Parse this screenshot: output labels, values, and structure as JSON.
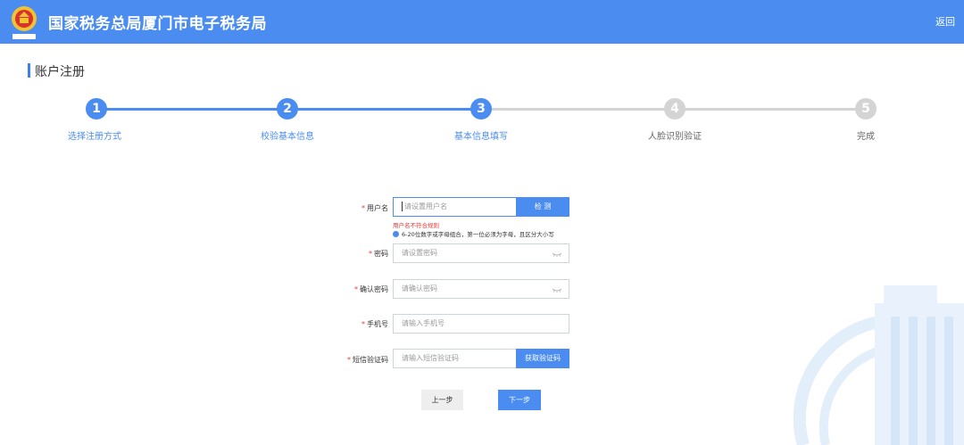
{
  "header": {
    "title": "国家税务总局厦门市电子税务局",
    "back": "返回",
    "emblem_caption": "中国税务"
  },
  "page": {
    "title": "账户注册"
  },
  "steps": [
    {
      "number": "1",
      "label": "选择注册方式",
      "state": "done"
    },
    {
      "number": "2",
      "label": "校验基本信息",
      "state": "done"
    },
    {
      "number": "3",
      "label": "基本信息填写",
      "state": "active"
    },
    {
      "number": "4",
      "label": "人脸识别验证",
      "state": "pending"
    },
    {
      "number": "5",
      "label": "完成",
      "state": "pending"
    }
  ],
  "colors": {
    "brand": "#4a8cf0",
    "pending": "#d4d4d4",
    "required": "#e23b3b"
  },
  "form": {
    "username": {
      "label": "用户名",
      "placeholder": "请设置用户名",
      "check_button": "检 测",
      "error": "用户名不符合规则",
      "hint": "6-20位数字或字母组合，第一位必须为字母，且区分大小写"
    },
    "password": {
      "label": "密码",
      "placeholder": "请设置密码"
    },
    "confirm_password": {
      "label": "确认密码",
      "placeholder": "请确认密码"
    },
    "phone": {
      "label": "手机号",
      "placeholder": "请输入手机号"
    },
    "sms_code": {
      "label": "短信验证码",
      "placeholder": "请输入短信验证码",
      "get_code_button": "获取验证码"
    },
    "required_mark": "*"
  },
  "actions": {
    "prev": "上一步",
    "next": "下一步"
  }
}
